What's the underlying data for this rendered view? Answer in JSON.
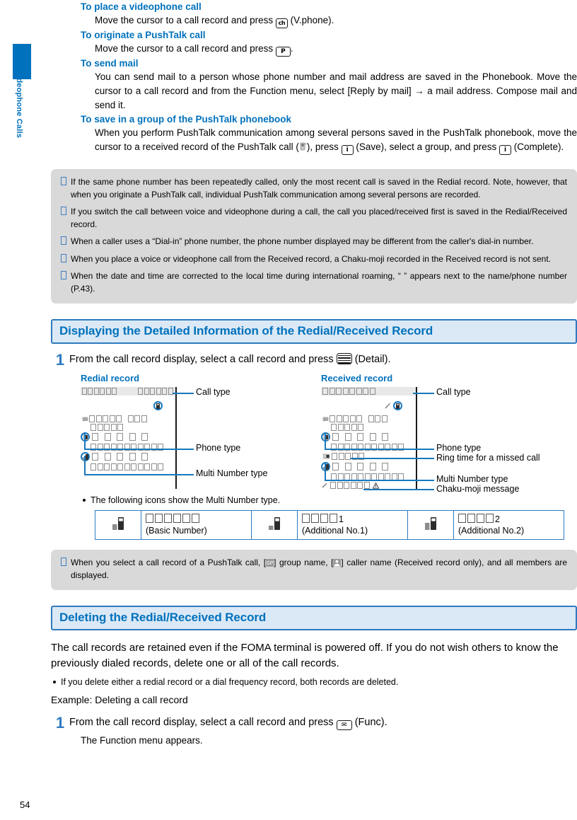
{
  "page": {
    "number": "54",
    "side_tab_label": "Voice/Videophone Calls",
    "accent_blue": "#0071bc",
    "section_bar_bg": "#dbe9f6",
    "section_bar_border": "#2e7ac0",
    "note_bg": "#d9d9d9",
    "callout_blue": "#1878be"
  },
  "top_sections": [
    {
      "heading": "To place a videophone call",
      "body_pre": "Move the cursor to a call record and press ",
      "key": "ch",
      "key_name": "videophone-key-icon",
      "body_post": " (V.phone)."
    },
    {
      "heading": "To originate a PushTalk call",
      "body_pre": "Move the cursor to a call record and press ",
      "key": "P",
      "key_name": "pushtalk-key-icon",
      "body_post": "."
    },
    {
      "heading": "To send mail",
      "body_full": "You can send mail to a person whose phone number and mail address are saved in the Phonebook. Move the cursor to a call record and from the Function menu, select [Reply by mail] → a mail address. Compose mail and send it."
    },
    {
      "heading": "To save in a group of the PushTalk phonebook",
      "body_part1": "When you perform PushTalk communication among several persons saved in the PushTalk phonebook, move the cursor to a received record of the PushTalk call (",
      "body_part2": "), press ",
      "body_part3": " (Save), select a group, and press ",
      "body_part4": " (Complete).",
      "key_save": "i",
      "key_complete": "i"
    }
  ],
  "note_box_1": {
    "items": [
      "If the same phone number has been repeatedly called, only the most recent call is saved in the Redial record. Note, however, that when you originate a PushTalk call, individual PushTalk communication among several persons are recorded.",
      "If you switch the call between voice and videophone during a call, the call you placed/received first is saved in the Redial/Received record.",
      "When a caller uses a “Dial-in” phone number, the phone number displayed may be different from the caller's dial-in number.",
      "When you place a voice or videophone call from the Received record, a Chaku-moji recorded in the Received record is not sent.",
      "When the date and time are corrected to the local time during international roaming, “ ” appears next to the name/phone number (P.43)."
    ]
  },
  "section_1": {
    "title": "Displaying the Detailed Information of the Redial/Received Record",
    "step_number": "1",
    "step_text_pre": "From the call record display, select a call record and press ",
    "step_text_post": " (Detail)."
  },
  "diagram": {
    "left_title": "Redial record",
    "right_title": "Received record",
    "left_labels": [
      "Call type",
      "Phone type",
      "Multi Number type"
    ],
    "right_labels": [
      "Call type",
      "Phone type",
      "Ring time for a missed call",
      "Multi Number type",
      "Chaku-moji message"
    ]
  },
  "icon_note": "The following icons show the Multi Number type.",
  "icon_table": [
    {
      "label_jp": "　　　　　　",
      "label_en": "(Basic Number)",
      "icon": "multinumber-basic-icon"
    },
    {
      "label_jp": "　　　　1",
      "label_en": "(Additional No.1)",
      "icon": "multinumber-add1-icon"
    },
    {
      "label_jp": "　　　　2",
      "label_en": "(Additional No.2)",
      "icon": "multinumber-add2-icon"
    }
  ],
  "note_box_2": {
    "text_part1": "When you select a call record of a PushTalk call, [",
    "text_part2": "] group name, [",
    "text_part3": "] caller name (Received record only), and all members are displayed."
  },
  "section_2": {
    "title": "Deleting the Redial/Received Record",
    "paragraph": "The call records are retained even if the FOMA terminal is powered off. If you do not wish others to know the previously dialed records, delete one or all of the call records.",
    "bullet": "If you delete either a redial record or a dial frequency record, both records are deleted.",
    "example": "Example: Deleting a call record",
    "step_number": "1",
    "step_text_pre": "From the call record display, select a call record and press ",
    "step_text_post": " (Func).",
    "step_sub": "The Function menu appears.",
    "func_key": "✉"
  }
}
